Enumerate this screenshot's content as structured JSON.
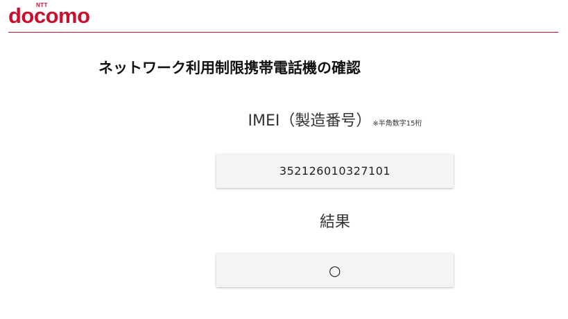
{
  "brand": {
    "ntt": "NTT",
    "name": "docomo",
    "color": "#c8102e"
  },
  "page": {
    "title": "ネットワーク利用制限携帯電話機の確認"
  },
  "imei": {
    "label": "IMEI（製造番号）",
    "note": "※半角数字15桁",
    "value": "352126010327101"
  },
  "result": {
    "label": "結果",
    "value": "○"
  }
}
